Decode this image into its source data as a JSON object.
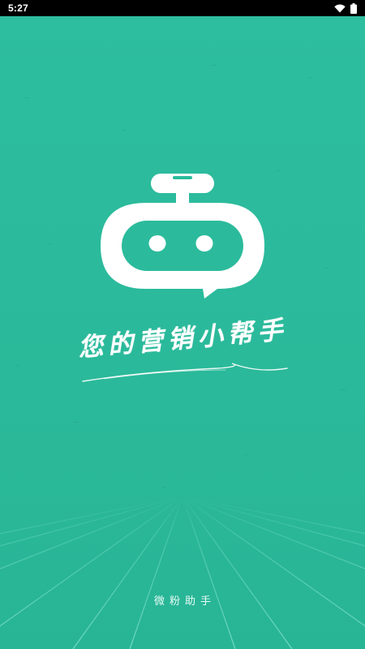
{
  "status_bar": {
    "time": "5:27",
    "icons": [
      "wifi-icon",
      "battery-icon"
    ]
  },
  "splash": {
    "logo_icon": "robot-chat-icon",
    "tagline": "您的营销小帮手",
    "footer_app_name": "微粉助手"
  },
  "colors": {
    "background": "#2bbb9c",
    "grid_lines": "#6fd9c1",
    "foreground": "#ffffff"
  }
}
